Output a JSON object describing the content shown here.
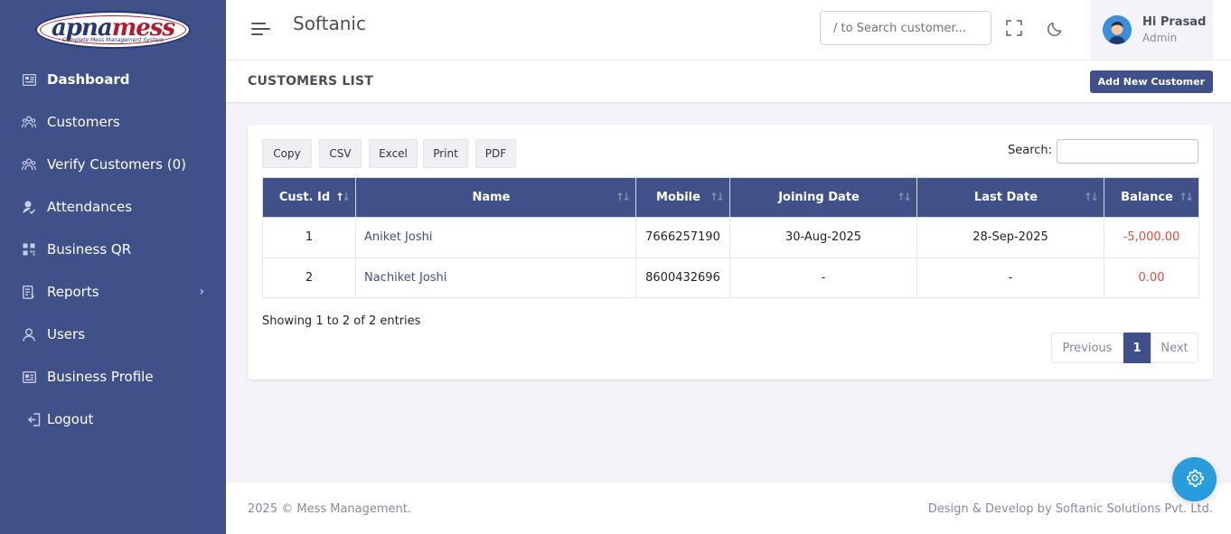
{
  "logo": {
    "text_a": "apna",
    "text_b": "mess",
    "tagline": "Complete Mess Management System"
  },
  "sidebar": {
    "items": [
      {
        "label": "Dashboard",
        "icon": "dashboard-icon"
      },
      {
        "label": "Customers",
        "icon": "customers-icon"
      },
      {
        "label": "Verify Customers (0)",
        "icon": "verify-icon"
      },
      {
        "label": "Attendances",
        "icon": "attendance-icon"
      },
      {
        "label": "Business QR",
        "icon": "qr-icon"
      },
      {
        "label": "Reports",
        "icon": "reports-icon"
      },
      {
        "label": "Users",
        "icon": "user-icon"
      },
      {
        "label": "Business Profile",
        "icon": "profile-card-icon"
      },
      {
        "label": "Logout",
        "icon": "logout-icon"
      }
    ]
  },
  "header": {
    "brand": "Softanic",
    "search_placeholder": "/ to Search customer...",
    "user_greeting": "Hi Prasad",
    "user_role": "Admin"
  },
  "page": {
    "title": "CUSTOMERS LIST",
    "add_button": "Add New Customer"
  },
  "toolbar": {
    "buttons": [
      "Copy",
      "CSV",
      "Excel",
      "Print",
      "PDF"
    ],
    "search_label": "Search:"
  },
  "table": {
    "columns": [
      "Cust. Id",
      "Name",
      "Mobile",
      "Joining Date",
      "Last Date",
      "Balance"
    ],
    "rows": [
      [
        "1",
        "Aniket Joshi",
        "7666257190",
        "30-Aug-2025",
        "28-Sep-2025",
        "-5,000.00"
      ],
      [
        "2",
        "Nachiket Joshi",
        "8600432696",
        "-",
        "-",
        "0.00"
      ]
    ]
  },
  "pagination": {
    "info": "Showing 1 to 2 of 2 entries",
    "previous": "Previous",
    "current": "1",
    "next": "Next"
  },
  "footer": {
    "left": "2025 © Mess Management.",
    "right": "Design & Develop by Softanic Solutions Pvt. Ltd."
  },
  "colors": {
    "primary": "#405189",
    "danger": "#e24b36",
    "info": "#299cdb"
  }
}
